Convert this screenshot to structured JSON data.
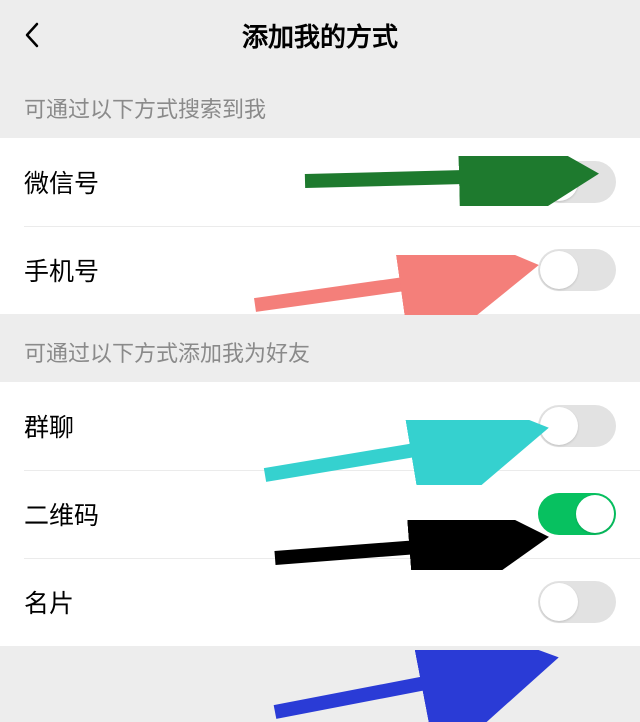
{
  "header": {
    "title": "添加我的方式"
  },
  "section1": {
    "label": "可通过以下方式搜索到我",
    "items": [
      {
        "label": "微信号",
        "on": false
      },
      {
        "label": "手机号",
        "on": false
      }
    ]
  },
  "section2": {
    "label": "可通过以下方式添加我为好友",
    "items": [
      {
        "label": "群聊",
        "on": false
      },
      {
        "label": "二维码",
        "on": true
      },
      {
        "label": "名片",
        "on": false
      }
    ]
  },
  "annotations": {
    "arrow_colors": {
      "wechat_id": "#1e7a2e",
      "phone": "#f47f7a",
      "group": "#35d1cf",
      "qrcode": "#000000",
      "card": "#2a3bd6"
    }
  }
}
